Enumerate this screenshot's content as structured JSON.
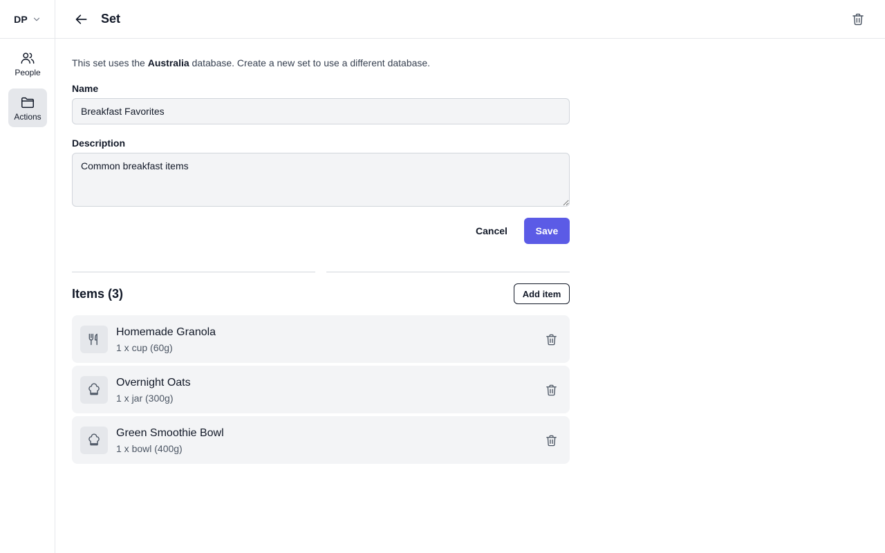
{
  "account": {
    "initials": "DP",
    "icon": "chevron-down-icon"
  },
  "sidebar": {
    "items": [
      {
        "label": "People",
        "icon": "people-icon",
        "active": false
      },
      {
        "label": "Actions",
        "icon": "folder-icon",
        "active": true
      }
    ]
  },
  "header": {
    "title": "Set",
    "back_icon": "arrow-left-icon",
    "delete_icon": "trash-icon"
  },
  "info": {
    "prefix": "This set uses the",
    "database": "Australia",
    "suffix": "database. Create a new set to use a different database."
  },
  "form": {
    "name_label": "Name",
    "name_value": "Breakfast Favorites",
    "description_label": "Description",
    "description_value": "Common breakfast items",
    "cancel_label": "Cancel",
    "save_label": "Save"
  },
  "colors": {
    "primary": "#5b5be6",
    "surface": "#f3f4f6",
    "border": "#e5e7eb"
  },
  "items": {
    "title": "Items (3)",
    "add_label": "Add item",
    "list": [
      {
        "name": "Homemade Granola",
        "quantity": "1 x cup (60g)",
        "icon": "utensils-icon"
      },
      {
        "name": "Overnight Oats",
        "quantity": "1 x jar (300g)",
        "icon": "chef-hat-icon"
      },
      {
        "name": "Green Smoothie Bowl",
        "quantity": "1 x bowl (400g)",
        "icon": "chef-hat-icon"
      }
    ]
  }
}
